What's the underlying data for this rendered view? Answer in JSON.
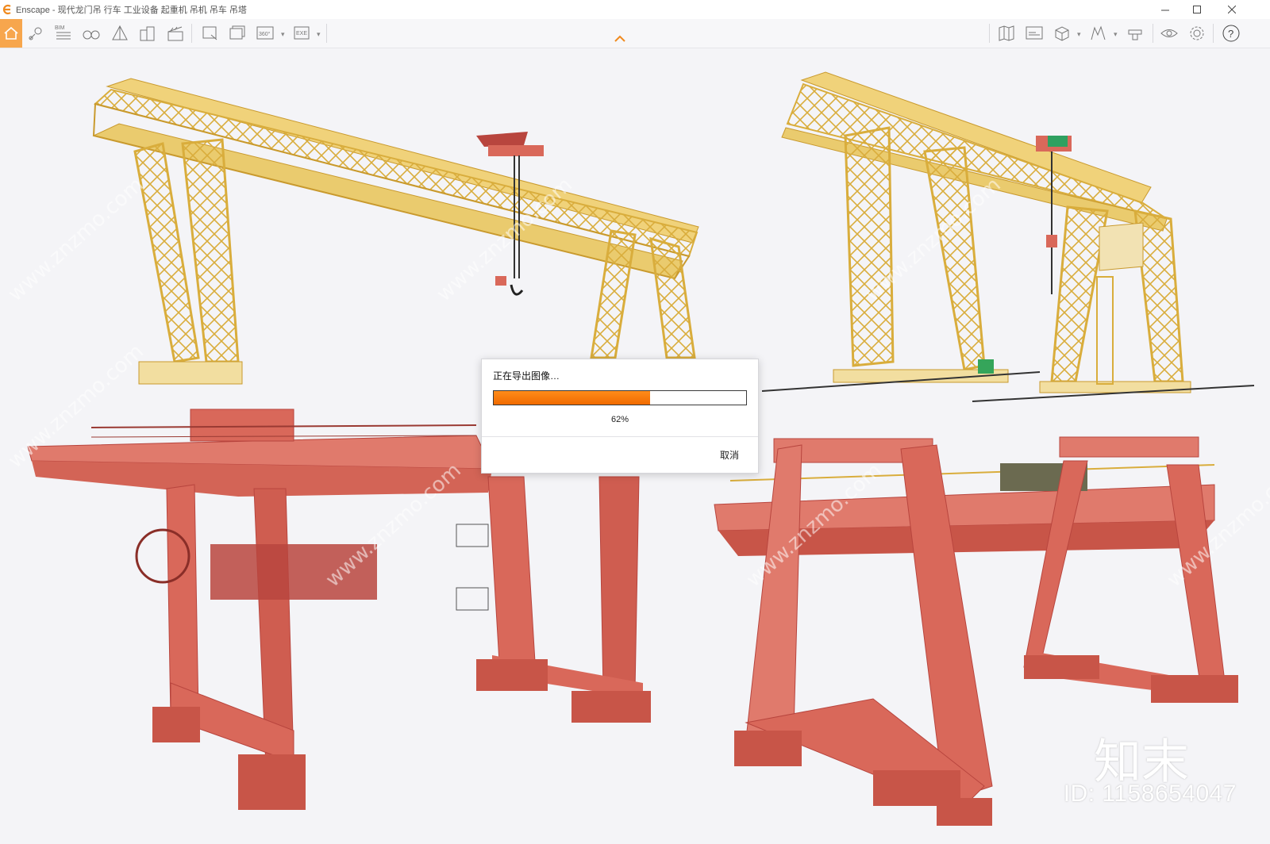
{
  "window": {
    "app_name": "Enscape",
    "title": "Enscape - 现代龙门吊 行车 工业设备 起重机 吊机 吊车 吊塔",
    "minimize_icon": "minimize-icon",
    "maximize_icon": "maximize-icon",
    "close_icon": "close-icon"
  },
  "toolbar": {
    "accent": "#f7a64d",
    "left_icons": [
      "home-icon",
      "map-pin-icon",
      "bim-icon",
      "binoculars-icon",
      "perspective-icon",
      "building-icon",
      "clapper-icon",
      "screenshot-export-icon",
      "batch-export-icon",
      "panorama-360-icon",
      "exe-export-icon"
    ],
    "bim_label": "BIM",
    "pano_label": "360°",
    "exe_label": "EXE",
    "right_icons": [
      "map-icon",
      "video-editor-icon",
      "asset-library-icon",
      "visual-settings-icon",
      "material-editor-icon",
      "view-mode-icon",
      "settings-icon",
      "help-icon"
    ]
  },
  "export_dialog": {
    "title": "正在导出图像…",
    "progress_percent": 62,
    "progress_label": "62%",
    "cancel_label": "取消",
    "progress_color": "#f06a00"
  },
  "scene": {
    "yellow_crane_color": "#e8c55d",
    "red_crane_color": "#d9685a"
  },
  "watermark": {
    "site_text": "www.znzmo.com",
    "logo_text": "知末",
    "id_text": "ID: 1158654047"
  }
}
